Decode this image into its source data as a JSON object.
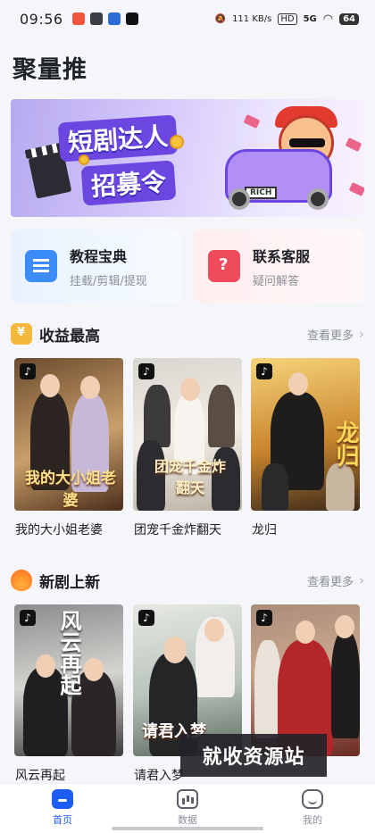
{
  "status_bar": {
    "time": "09:56",
    "net_speed": "111 KB/s",
    "hd": "HD",
    "signal": "5G",
    "battery": "64"
  },
  "app": {
    "title": "聚量推"
  },
  "banner": {
    "line1": "短剧达人",
    "line2": "招募令",
    "plate": "RICH"
  },
  "quick_cards": [
    {
      "title": "教程宝典",
      "subtitle": "挂载/剪辑/提现",
      "icon": "document-icon"
    },
    {
      "title": "联系客服",
      "subtitle": "疑问解答",
      "icon": "chat-question-icon"
    }
  ],
  "sections": [
    {
      "title": "收益最高",
      "more": "查看更多",
      "icon": "coin-bag-icon",
      "items": [
        {
          "caption": "我的大小姐老婆",
          "poster_text": "我的大小姐老婆"
        },
        {
          "caption": "团宠千金炸翻天",
          "poster_text": "团宠千金炸翻天"
        },
        {
          "caption": "龙归",
          "poster_text": "龙归"
        }
      ]
    },
    {
      "title": "新剧上新",
      "more": "查看更多",
      "icon": "fire-icon",
      "items": [
        {
          "caption": "风云再起",
          "poster_text": "风云再起"
        },
        {
          "caption": "请君入梦",
          "poster_text": "请君入梦"
        },
        {
          "caption": "",
          "poster_text": ""
        }
      ]
    }
  ],
  "watermark": "就收资源站",
  "bottom_nav": [
    {
      "label": "首页",
      "active": true
    },
    {
      "label": "数据",
      "active": false
    },
    {
      "label": "我的",
      "active": false
    }
  ],
  "colors": {
    "accent": "#1d5df5",
    "background": "#f4f6f9"
  }
}
